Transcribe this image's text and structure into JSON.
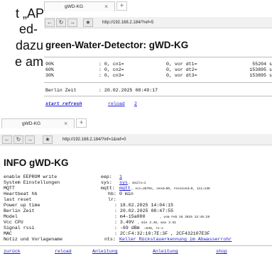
{
  "doc_lines": [
    "t „AP“",
    "ed-",
    "dazu",
    "e am"
  ],
  "window1": {
    "tab_title": "gWD-KG",
    "tab_close": "×",
    "new_tab": "+",
    "url": "http://192.168.2.184/?ref=5",
    "heading": "green-Water-Detector: gWD-KG",
    "rows": [
      {
        "pct": "90%",
        "cn": ": 0, cn1=",
        "vor": "0, vor dt1=",
        "val": "55204 s"
      },
      {
        "pct": "60%",
        "cn": ": 0, cn2=",
        "vor": "0, vor dt2=",
        "val": "153895 s"
      },
      {
        "pct": "30%",
        "cn": ": 0, cn3=",
        "vor": "0, vor dt3=",
        "val": "153895 s"
      }
    ],
    "berlin_label": "Berlin Zeit",
    "berlin_value": ": 20.02.2025 08:49:17",
    "link_start": "start refresh",
    "link_reload": "reload",
    "link_2": "2"
  },
  "window2": {
    "tab_title": "gWD-KG",
    "tab_close": "×",
    "new_tab": "+",
    "url": "http://192.168.2.184/?inf=1&ref=0",
    "heading": "INFO gWD-KG",
    "eep_label": "enable EEPROM write",
    "eep_key": "eep:",
    "eep_val": "1",
    "sys_label": "System Einstellungen",
    "sys_key": "sys:",
    "sys_link": "sys",
    "sys_rest": ", mails=1",
    "mqtt_label": "MQTT",
    "mqtt_key": "mqtt:",
    "mqtt_link": "mqtt",
    "mqtt_rest": ", vcc=2670s, send=50, received=0, ini=138",
    "hb_label": "Heartbeat hb",
    "hb_key": "hb:",
    "hb_val": "0 min",
    "lr_label": "last reset",
    "lr_key": "lr:",
    "lr_val": "",
    "pot_label": "Power up time",
    "pot_val": ": 18.02.2025 14:04:15",
    "bz_label": "Berlin Zeit",
    "bz_val": ": 20.02.2025 08:47:55",
    "model_label": "Model",
    "model_val": ": m4-15a000",
    "model_small": ", vom Feb 18 2025 13:45:29",
    "vcc_label": "Vcc CPU",
    "vcc_val": ": 3.49V",
    "vcc_small": ", min 3.49, max 3.51",
    "rssi_label": "Signal rssi",
    "rssi_val": ": -69 dBm",
    "rssi_small": "=64%, rs-x",
    "mac_label": "MAC",
    "mac_val": ": 2C:F4:32:10:7E:3F , 2CF432107E3F",
    "notiz_label": "Notiz und Vorlagename",
    "notiz_key": "nts:",
    "notiz_link": "Keller Rückstauerkennung im Abwasserrohr",
    "footer": [
      "zurück",
      "reload",
      "Anleitung",
      "Anleitung",
      "shop"
    ]
  }
}
